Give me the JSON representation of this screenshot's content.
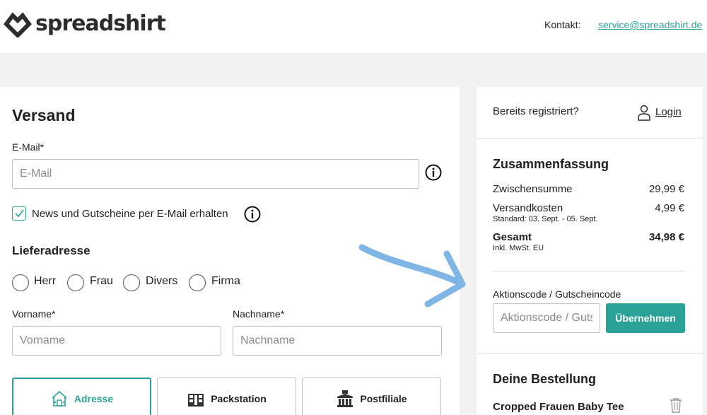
{
  "header": {
    "logo_text": "spreadshirt",
    "contact_label": "Kontakt:",
    "contact_email": "service@spreadshirt.de"
  },
  "shipping": {
    "title": "Versand",
    "email_label": "E-Mail*",
    "email_placeholder": "E-Mail",
    "newsletter_label": "News und Gutscheine per E-Mail erhalten",
    "newsletter_checked": true,
    "address_title": "Lieferadresse",
    "salutations": [
      "Herr",
      "Frau",
      "Divers",
      "Firma"
    ],
    "firstname_label": "Vorname*",
    "firstname_placeholder": "Vorname",
    "lastname_label": "Nachname*",
    "lastname_placeholder": "Nachname",
    "delivery_options": [
      "Adresse",
      "Packstation",
      "Postfiliale"
    ],
    "delivery_selected": "Adresse"
  },
  "sidebar": {
    "registered_label": "Bereits registriert?",
    "login_label": "Login",
    "summary_title": "Zusammenfassung",
    "subtotal_label": "Zwischensumme",
    "subtotal_value": "29,99 €",
    "shipping_label": "Versandkosten",
    "shipping_value": "4,99 €",
    "shipping_note": "Standard: 03. Sept. - 05. Sept.",
    "total_label": "Gesamt",
    "total_value": "34,98 €",
    "total_note": "Inkl. MwSt. EU",
    "coupon_label": "Aktionscode / Gutscheincode",
    "coupon_placeholder": "Aktionscode / Gutscheincode",
    "apply_label": "Übernehmen",
    "order_title": "Deine Bestellung",
    "order_item": "Cropped Frauen Baby Tee"
  },
  "colors": {
    "accent": "#2ba297",
    "arrow": "#7fb6e6"
  }
}
